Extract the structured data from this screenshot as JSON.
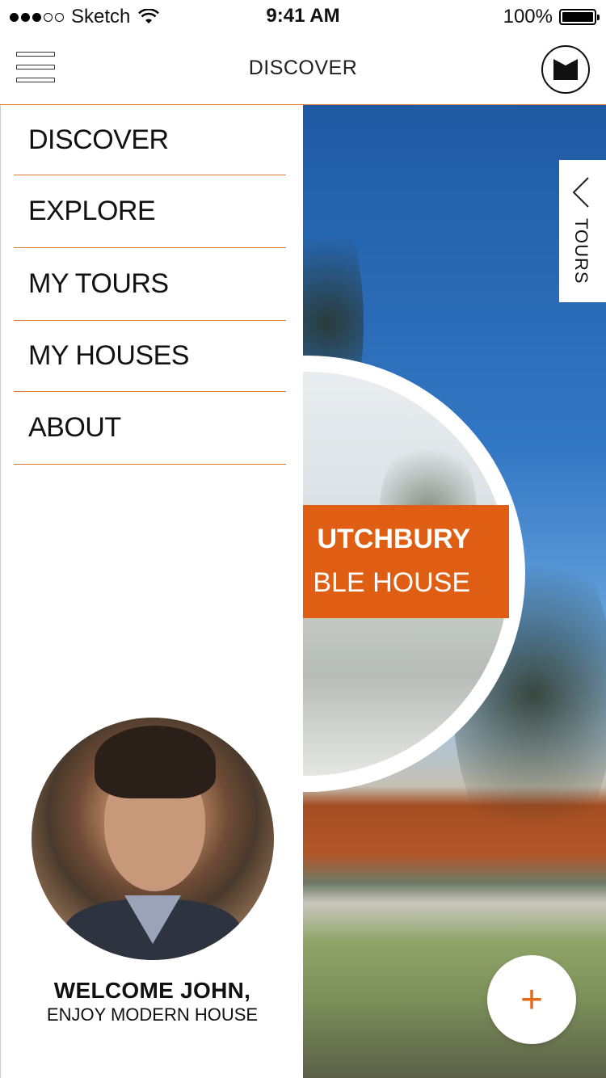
{
  "status_bar": {
    "carrier": "Sketch",
    "time": "9:41 AM",
    "battery": "100%"
  },
  "nav": {
    "title": "DISCOVER",
    "menu_icon": "hamburger-icon",
    "logo_icon": "brand-logo-icon"
  },
  "drawer": {
    "items": [
      {
        "label": "DISCOVER"
      },
      {
        "label": "EXPLORE"
      },
      {
        "label": "MY TOURS"
      },
      {
        "label": "MY HOUSES"
      },
      {
        "label": "ABOUT"
      }
    ],
    "welcome": "WELCOME JOHN,",
    "subtitle": "ENJOY MODERN HOUSE"
  },
  "feature": {
    "title": "UTCHBURY",
    "subtitle": "BLE HOUSE"
  },
  "tours_tab": {
    "label": "TOURS",
    "icon": "chevron-left-icon"
  },
  "add_button": {
    "label": "+"
  },
  "colors": {
    "accent": "#e05e13",
    "divider": "#e07a2e"
  }
}
